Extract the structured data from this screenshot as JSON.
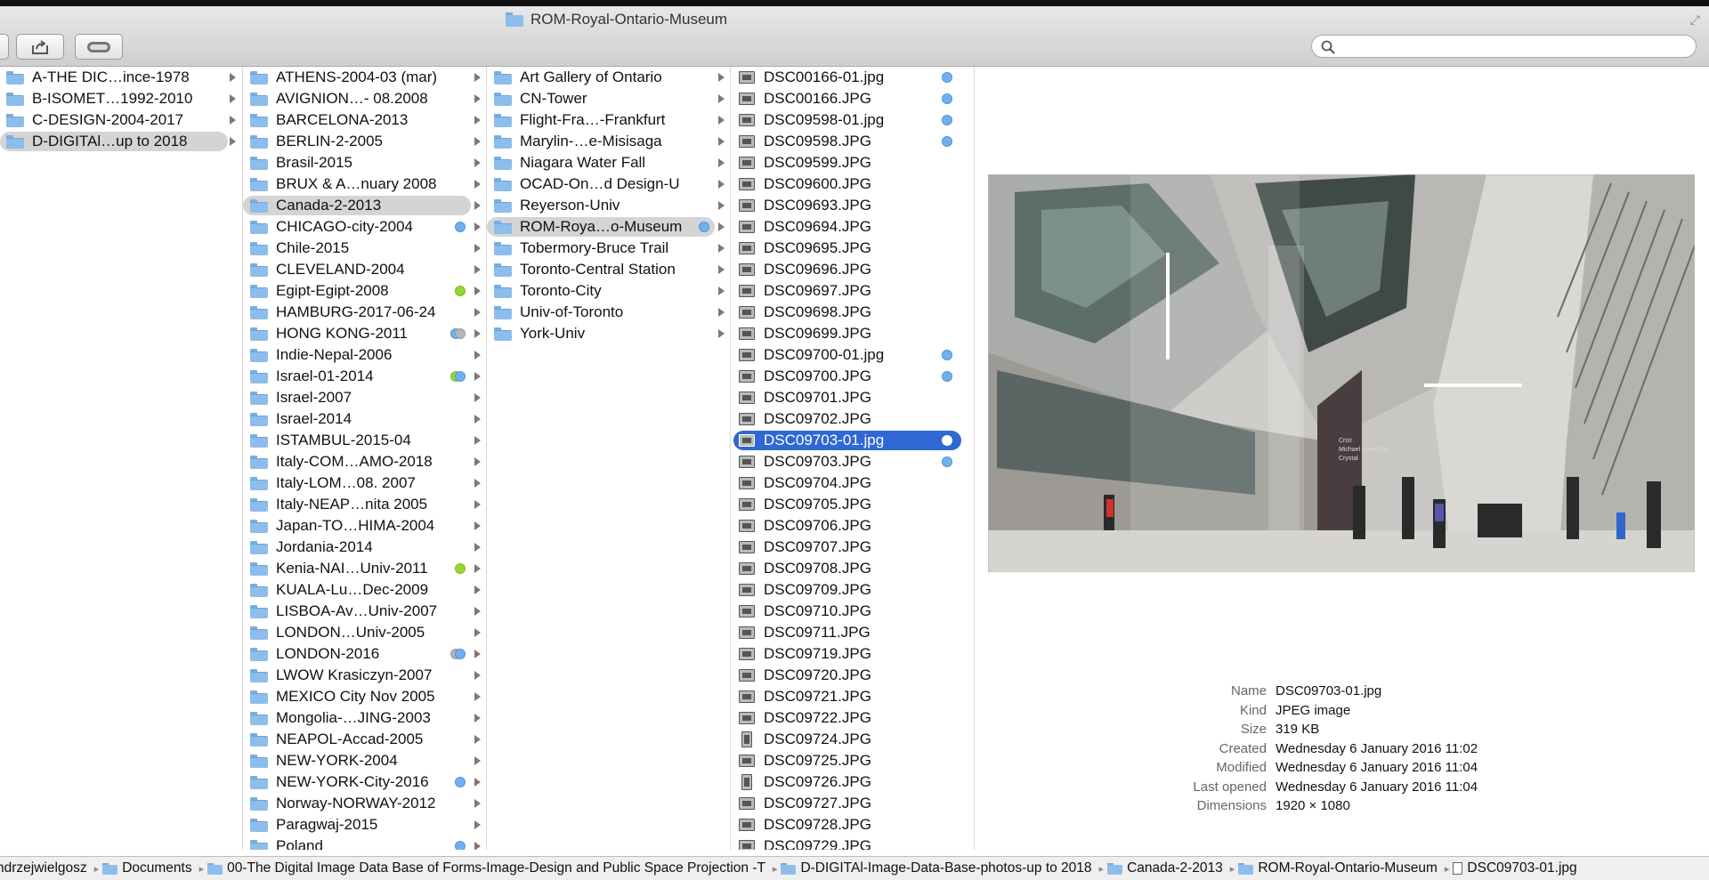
{
  "window": {
    "title": "ROM-Royal-Ontario-Museum",
    "search_placeholder": ""
  },
  "columns": {
    "col1": [
      {
        "name": "A-THE DIC…ince-1978"
      },
      {
        "name": "B-ISOMET…1992-2010"
      },
      {
        "name": "C-DESIGN-2004-2017"
      },
      {
        "name": "D-DIGITAl…up to 2018",
        "selected": true
      }
    ],
    "col2": [
      {
        "name": "ATHENS-2004-03 (mar)"
      },
      {
        "name": "AVIGNION…- 08.2008"
      },
      {
        "name": "BARCELONA-2013"
      },
      {
        "name": "BERLIN-2-2005"
      },
      {
        "name": "Brasil-2015"
      },
      {
        "name": "BRUX & A…nuary 2008"
      },
      {
        "name": "Canada-2-2013",
        "selected": true
      },
      {
        "name": "CHICAGO-city-2004",
        "tags": [
          "blue"
        ]
      },
      {
        "name": "Chile-2015"
      },
      {
        "name": "CLEVELAND-2004"
      },
      {
        "name": "Egipt-Egipt-2008",
        "tags": [
          "green"
        ]
      },
      {
        "name": "HAMBURG-2017-06-24"
      },
      {
        "name": "HONG KONG-2011",
        "tags": [
          "blue",
          "grey"
        ]
      },
      {
        "name": "Indie-Nepal-2006"
      },
      {
        "name": "Israel-01-2014",
        "tags": [
          "green",
          "blue"
        ]
      },
      {
        "name": "Israel-2007"
      },
      {
        "name": "Israel-2014"
      },
      {
        "name": "ISTAMBUL-2015-04"
      },
      {
        "name": "Italy-COM…AMO-2018"
      },
      {
        "name": "Italy-LOM…08. 2007"
      },
      {
        "name": "Italy-NEAP…nita 2005"
      },
      {
        "name": "Japan-TO…HIMA-2004"
      },
      {
        "name": "Jordania-2014"
      },
      {
        "name": "Kenia-NAI…Univ-2011",
        "tags": [
          "green"
        ]
      },
      {
        "name": "KUALA-Lu…Dec-2009"
      },
      {
        "name": "LISBOA-Av…Univ-2007"
      },
      {
        "name": "LONDON…Univ-2005"
      },
      {
        "name": "LONDON-2016",
        "tags": [
          "grey",
          "blue"
        ]
      },
      {
        "name": "LWOW Krasiczyn-2007"
      },
      {
        "name": "MEXICO City Nov 2005"
      },
      {
        "name": "Mongolia-…JING-2003"
      },
      {
        "name": "NEAPOL-Accad-2005"
      },
      {
        "name": "NEW-YORK-2004"
      },
      {
        "name": "NEW-YORK-City-2016",
        "tags": [
          "blue"
        ]
      },
      {
        "name": "Norway-NORWAY-2012"
      },
      {
        "name": "Paragwaj-2015"
      },
      {
        "name": "Poland",
        "tags": [
          "blue"
        ]
      }
    ],
    "col3": [
      {
        "name": "Art Gallery of Ontario"
      },
      {
        "name": "CN-Tower"
      },
      {
        "name": "Flight-Fra…-Frankfurt"
      },
      {
        "name": "Marylin-…e-Misisaga"
      },
      {
        "name": "Niagara Water Fall"
      },
      {
        "name": "OCAD-On…d Design-U"
      },
      {
        "name": "Reyerson-Univ"
      },
      {
        "name": "ROM-Roya…o-Museum",
        "selected": true,
        "tags": [
          "blue"
        ]
      },
      {
        "name": "Tobermory-Bruce Trail"
      },
      {
        "name": "Toronto-Central Station"
      },
      {
        "name": "Toronto-City"
      },
      {
        "name": "Univ-of-Toronto"
      },
      {
        "name": "York-Univ"
      }
    ],
    "col4": [
      {
        "name": "DSC00166-01.jpg",
        "tags": [
          "blue"
        ]
      },
      {
        "name": "DSC00166.JPG",
        "tags": [
          "blue"
        ]
      },
      {
        "name": "DSC09598-01.jpg",
        "tags": [
          "blue"
        ]
      },
      {
        "name": "DSC09598.JPG",
        "tags": [
          "blue"
        ]
      },
      {
        "name": "DSC09599.JPG"
      },
      {
        "name": "DSC09600.JPG"
      },
      {
        "name": "DSC09693.JPG"
      },
      {
        "name": "DSC09694.JPG"
      },
      {
        "name": "DSC09695.JPG"
      },
      {
        "name": "DSC09696.JPG"
      },
      {
        "name": "DSC09697.JPG"
      },
      {
        "name": "DSC09698.JPG"
      },
      {
        "name": "DSC09699.JPG"
      },
      {
        "name": "DSC09700-01.jpg",
        "tags": [
          "blue"
        ]
      },
      {
        "name": "DSC09700.JPG",
        "tags": [
          "blue"
        ]
      },
      {
        "name": "DSC09701.JPG"
      },
      {
        "name": "DSC09702.JPG"
      },
      {
        "name": "DSC09703-01.jpg",
        "selected": true,
        "tags": [
          "blue"
        ]
      },
      {
        "name": "DSC09703.JPG",
        "tags": [
          "blue"
        ]
      },
      {
        "name": "DSC09704.JPG"
      },
      {
        "name": "DSC09705.JPG"
      },
      {
        "name": "DSC09706.JPG"
      },
      {
        "name": "DSC09707.JPG"
      },
      {
        "name": "DSC09708.JPG"
      },
      {
        "name": "DSC09709.JPG"
      },
      {
        "name": "DSC09710.JPG"
      },
      {
        "name": "DSC09711.JPG"
      },
      {
        "name": "DSC09719.JPG"
      },
      {
        "name": "DSC09720.JPG"
      },
      {
        "name": "DSC09721.JPG"
      },
      {
        "name": "DSC09722.JPG"
      },
      {
        "name": "DSC09724.JPG",
        "portrait": true
      },
      {
        "name": "DSC09725.JPG"
      },
      {
        "name": "DSC09726.JPG",
        "portrait": true
      },
      {
        "name": "DSC09727.JPG"
      },
      {
        "name": "DSC09728.JPG"
      },
      {
        "name": "DSC09729.JPG"
      }
    ]
  },
  "preview": {
    "sign_text_1": "Crist",
    "sign_text_2": "Michael Lee-Chin",
    "sign_text_3": "Crystal"
  },
  "info": {
    "rows": [
      {
        "label": "Name",
        "value": "DSC09703-01.jpg"
      },
      {
        "label": "Kind",
        "value": "JPEG image"
      },
      {
        "label": "Size",
        "value": "319 KB"
      },
      {
        "label": "Created",
        "value": "Wednesday 6 January 2016 11:02"
      },
      {
        "label": "Modified",
        "value": "Wednesday 6 January 2016 11:04"
      },
      {
        "label": "Last opened",
        "value": "Wednesday 6 January 2016 11:04"
      },
      {
        "label": "Dimensions",
        "value": "1920 × 1080"
      }
    ]
  },
  "pathbar": [
    {
      "name": "ndrzejwielgosz",
      "icon": "none"
    },
    {
      "name": "Documents",
      "icon": "folder"
    },
    {
      "name": "00-The Digital Image Data Base of Forms-Image-Design and Public Space Projection -T",
      "icon": "folder"
    },
    {
      "name": "D-DIGITAl-Image-Data-Base-photos-up to 2018",
      "icon": "folder"
    },
    {
      "name": "Canada-2-2013",
      "icon": "folder"
    },
    {
      "name": "ROM-Royal-Ontario-Museum",
      "icon": "folder"
    },
    {
      "name": "DSC09703-01.jpg",
      "icon": "file"
    }
  ],
  "colors": {
    "selection_blue": "#2f68d4",
    "selection_grey": "#d4d4d4",
    "tag_blue": "#6fb1ef",
    "tag_green": "#95d733",
    "tag_grey": "#b5b5b5"
  }
}
